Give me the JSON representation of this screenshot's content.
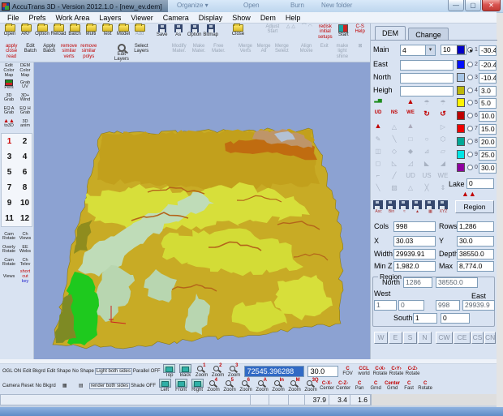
{
  "titlebar": {
    "title": "AccuTrans 3D - Version 2012.1.0 - [new_ev.dem]",
    "explorer_items": [
      "Organize ▾",
      "Open",
      "Burn",
      "New folder"
    ],
    "window_buttons": {
      "minimize": "—",
      "maximize": "▢",
      "close": "✕"
    }
  },
  "menu_bar": [
    "File",
    "Prefs",
    "Work Area",
    "Layers",
    "Viewer",
    "Camera",
    "Display",
    "Show",
    "Dem",
    "Help"
  ],
  "main_toolbar": {
    "row1": [
      {
        "l": "Open",
        "ic": "folder"
      },
      {
        "l": "AKF",
        "ic": "folder"
      },
      {
        "l": "Option",
        "ic": "folder"
      },
      {
        "l": "Reload",
        "ic": "folder"
      },
      {
        "l": "Batch",
        "ic": "folder"
      },
      {
        "l": "Multi",
        "ic": "folder"
      },
      {
        "l": "Text",
        "ic": "folder"
      },
      {
        "l": "Model",
        "ic": "folder"
      },
      {
        "l": "Add",
        "ic": "folder",
        "dis": 1
      },
      {
        "g": 10
      },
      {
        "l": "Save",
        "ic": "floppy"
      },
      {
        "l": "As",
        "ic": "floppy"
      },
      {
        "l": "Option",
        "ic": "floppy"
      },
      {
        "l": "Bitmap",
        "ic": "floppy"
      },
      {
        "g": 18
      },
      {
        "l": "Close",
        "ic": "folder"
      },
      {
        "g": 26
      },
      {
        "l": "Adjust Start",
        "dis": 1
      },
      {
        "l": "△ △",
        "dis": 1
      },
      {
        "l": "⌒ ◠",
        "dis": 1
      },
      {
        "l": "redisk initial setups",
        "red": 1
      },
      {
        "l": "Start",
        "ic": "start"
      },
      {
        "l": "C-S Help",
        "red": 1
      }
    ],
    "row2": [
      {
        "l": "apply close read",
        "red": 1
      },
      {
        "l": "Edit Batch"
      },
      {
        "l": "Apply Batch"
      },
      {
        "l": "remove similar verts",
        "red": 1
      },
      {
        "l": "remove similar polys",
        "red": 1
      },
      {
        "g": 22
      },
      {
        "l": "Edit Layers",
        "ic": "mag"
      },
      {
        "l": "Select Layers"
      },
      {
        "g": 30
      },
      {
        "l": "Modify Mater.",
        "dis": 1
      },
      {
        "l": "Make Mater.",
        "dis": 1
      },
      {
        "l": "Free Mater.",
        "dis": 1
      },
      {
        "g": 12
      },
      {
        "l": "Merge Verts",
        "dis": 1
      },
      {
        "l": "Merge All",
        "dis": 1
      },
      {
        "l": "Merge Select",
        "dis": 1
      },
      {
        "g": 8
      },
      {
        "l": "Align Movie",
        "dis": 1
      },
      {
        "l": "Exit",
        "dis": 1
      },
      {
        "l": "make light shine",
        "dis": 1
      },
      {
        "l": "⊠",
        "dis": 1
      }
    ]
  },
  "sidebar": {
    "top": [
      {
        "l": "Edit Color Map",
        "cls": "darkred"
      },
      {
        "l": "DEM Color Map",
        "cls": "red"
      },
      {
        "l": "Pers",
        "ic": "flag"
      },
      {
        "l": "Grab UV",
        "dis": 1
      },
      {
        "l": "3D Grab",
        "dis": 1
      },
      {
        "l": "3D+ Wind",
        "dis": 1
      },
      {
        "l": "EQ A Grab",
        "dis": 1
      },
      {
        "l": "EQ H Grab",
        "dis": 1
      },
      {
        "l": "to3D",
        "ic": "mtn",
        "cls": "red"
      },
      {
        "l": "3D anim",
        "dis": 1
      }
    ],
    "numbers": [
      "1",
      "2",
      "3",
      "4",
      "5",
      "6",
      "7",
      "8",
      "9",
      "10",
      "11",
      "12"
    ],
    "active_number": "1",
    "bottom": [
      {
        "l": "Cam Rotate",
        "dis": 1
      },
      {
        "l": "Ch Views",
        "dis": 1
      },
      {
        "l": "Overly Rotate",
        "dis": 1
      },
      {
        "l": "EE Webs",
        "dis": 1
      },
      {
        "l": "Cam Rotate",
        "dis": 1
      },
      {
        "l": "Ch Telev",
        "dis": 1
      },
      {
        "l": "Views",
        "dis": 1
      },
      {
        "l": "short cut",
        "cls": "mix",
        "sub": "key"
      }
    ]
  },
  "right_panel": {
    "tabs": [
      {
        "label": "DEM",
        "active": true
      },
      {
        "label": "Change",
        "active": false
      }
    ],
    "rows": [
      {
        "label": "Main",
        "dropdown": "4",
        "field": "10"
      },
      {
        "label": "East",
        "field": ""
      },
      {
        "label": "North",
        "field": ""
      },
      {
        "label": "Heigh",
        "field": ""
      }
    ],
    "swatches": [
      {
        "c": "#0000C8",
        "n": "1",
        "v": "-30.4",
        "sel": true
      },
      {
        "c": "#0010FF",
        "n": "2",
        "v": "-20.4"
      },
      {
        "c": "#A8C6E6",
        "n": "3",
        "v": "-10.4"
      },
      {
        "c": "#BDB70A",
        "n": "4",
        "v": "3.0"
      },
      {
        "c": "#FFF200",
        "n": "5",
        "v": "5.0"
      },
      {
        "c": "#BE0000",
        "n": "6",
        "v": "10.0"
      },
      {
        "c": "#F00000",
        "n": "7",
        "v": "15.0"
      },
      {
        "c": "#00A896",
        "n": "8",
        "v": "20.0"
      },
      {
        "c": "#00E6E6",
        "n": "9",
        "v": "25.0"
      },
      {
        "c": "#8E00A0",
        "n": "0",
        "v": "30.0"
      }
    ],
    "icon_texts": [
      "UD",
      "NS",
      "WE"
    ],
    "lake": {
      "label": "Lake",
      "value": "0"
    },
    "region_button": "Region",
    "saves": [
      "Asc",
      "Bin",
      "≈",
      "▲",
      "▦",
      "XYZ"
    ],
    "fields": [
      {
        "label": "Cols",
        "value": "998"
      },
      {
        "label": "Rows",
        "value": "1,286"
      },
      {
        "label": "X",
        "value": "30.03"
      },
      {
        "label": "Y",
        "value": "30.0"
      },
      {
        "label": "Width",
        "value": "29939.91"
      },
      {
        "label": "Depth",
        "value": "38550.0"
      },
      {
        "label": "Min Z",
        "value": "1,982.0"
      },
      {
        "label": "Max",
        "value": "8,774.0"
      }
    ],
    "region": {
      "title": "Region",
      "north_label": "North",
      "north1": "1286",
      "north2": "38550.0",
      "west_label": "West",
      "east_label": "East",
      "w1": "1",
      "w2": "0",
      "e1": "998",
      "e2": "29939.9",
      "south_label": "South",
      "s1": "1",
      "s2": "0",
      "buttons": [
        "W",
        "E",
        "S",
        "N",
        "CW",
        "CE",
        "CS",
        "CN"
      ]
    }
  },
  "bottom_toolbar": {
    "row1": [
      {
        "l": "OGL ON",
        "red": 1
      },
      {
        "l": "Edit Bkgrd",
        "red": 1
      },
      {
        "l": "Edit Shape",
        "dis": 1
      },
      {
        "l": "No Shape",
        "dis": 1
      },
      {
        "l": "Light both sides",
        "red": 1,
        "box": 1
      },
      {
        "l": "Parallel OFF",
        "dis": 1
      },
      {
        "l": "Top",
        "ic": "view"
      },
      {
        "l": "Back",
        "ic": "view"
      },
      {
        "l": "Zoom",
        "ic": "zoom",
        "n": "1"
      },
      {
        "l": "Zoom",
        "ic": "zoom",
        "n": "2"
      },
      {
        "l": "Zoom",
        "ic": "zoom",
        "n": "3"
      },
      {
        "field": "field1"
      },
      {
        "field": "field2"
      },
      {
        "l": "C FOV",
        "cls": "cbl"
      },
      {
        "l": "CCL world",
        "cls": "cbl"
      },
      {
        "l": "C‹X› Rotate",
        "cls": "cbl"
      },
      {
        "l": "C‹Y› Rotate",
        "cls": "cbl"
      },
      {
        "l": "C‹Z› Rotate",
        "cls": "cbl"
      }
    ],
    "row2": [
      {
        "l": "Camera Reset",
        "red": 1
      },
      {
        "l": "No Bkgrd",
        "red": 1
      },
      {
        "l": "▦",
        "dis": 1
      },
      {
        "l": "▤",
        "dis": 1
      },
      {
        "l": "render both sides",
        "red": 1,
        "box": 1
      },
      {
        "l": "Shade OFF",
        "dis": 1
      },
      {
        "l": "Left",
        "ic": "view"
      },
      {
        "l": "Front",
        "ic": "view"
      },
      {
        "l": "Right",
        "ic": "view"
      },
      {
        "l": "Zoom",
        "ic": "zoom",
        "n": "4"
      },
      {
        "l": "Zoom",
        "ic": "zoom",
        "n": "5"
      },
      {
        "l": "Zoom",
        "ic": "zoom",
        "n": "6"
      },
      {
        "l": "Zoom",
        "ic": "zoom",
        "n": "A"
      },
      {
        "l": "Zoom",
        "ic": "zoom",
        "n": "In"
      },
      {
        "l": "Zoom",
        "ic": "zoom",
        "n": "M"
      },
      {
        "l": "Zoom",
        "ic": "zoom",
        "n": "3Q"
      },
      {
        "l": "C-X- Center",
        "cls": "cbl"
      },
      {
        "l": "C-Z- Center",
        "cls": "cbl"
      },
      {
        "l": "C Pan",
        "cls": "cbl"
      },
      {
        "l": "C Grnd",
        "cls": "cbl"
      },
      {
        "l": "Center Grnd",
        "cls": "cbl"
      },
      {
        "l": "C Fast",
        "cls": "cbl"
      },
      {
        "l": "C Rotate",
        "cls": "cbl"
      }
    ],
    "field1": "72545.396288",
    "field2": "30.0",
    "status": [
      "",
      "",
      "",
      "",
      "37.9",
      "3.4",
      "1.6"
    ]
  },
  "terrain_palette": {
    "bg": "#8CA2D2",
    "base": "#C8AB25",
    "north": "#C2A01C",
    "chartreuse": "#D7DF3A",
    "chartreuse2": "#D3DC36",
    "sage": "#BFDCB8",
    "sage2": "#B8D6B0",
    "green": "#1EC91E",
    "olive": "#7E8A24",
    "shadow": "#8F8C1E",
    "orange": "#C06C10",
    "orange_line": "#B4641A",
    "tan": "#BE9569",
    "snow": "#B3C1D4",
    "axis": "#CC2222"
  }
}
